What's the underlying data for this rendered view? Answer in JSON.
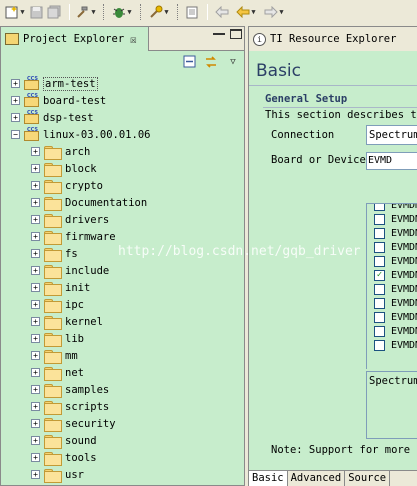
{
  "toolbar": {
    "icons": [
      "new-wizard-icon",
      "save-icon",
      "save-all-icon",
      "build-icon",
      "debug-icon",
      "run-tool-icon",
      "console-icon",
      "last-edit-icon",
      "back-icon",
      "forward-icon"
    ]
  },
  "project_explorer": {
    "tab_title": "Project Explorer",
    "tab_close": "☒",
    "projects": [
      {
        "label": "arm-test",
        "expanded": false
      },
      {
        "label": "board-test",
        "expanded": false
      },
      {
        "label": "dsp-test",
        "expanded": false
      },
      {
        "label": "linux-03.00.01.06",
        "expanded": true
      }
    ],
    "folders": [
      "arch",
      "block",
      "crypto",
      "Documentation",
      "drivers",
      "firmware",
      "fs",
      "include",
      "init",
      "ipc",
      "kernel",
      "lib",
      "mm",
      "net",
      "samples",
      "scripts",
      "security",
      "sound",
      "tools",
      "usr"
    ]
  },
  "resource_explorer": {
    "tab_title": "TI Resource Explorer",
    "heading": "Basic",
    "section_title": "General Setup",
    "section_desc": "This section describes th",
    "connection_label": "Connection",
    "connection_value": "Spectrum",
    "board_label": "Board or Device",
    "board_value": "EVMD",
    "board_list": [
      {
        "label": "EVMDM",
        "checked": false
      },
      {
        "label": "EVMDM",
        "checked": false
      },
      {
        "label": "EVMDM",
        "checked": false
      },
      {
        "label": "EVMDM",
        "checked": false
      },
      {
        "label": "EVMDM",
        "checked": false
      },
      {
        "label": "EVMDM",
        "checked": true
      },
      {
        "label": "EVMDM",
        "checked": false
      },
      {
        "label": "EVMDM",
        "checked": false
      },
      {
        "label": "EVMDM",
        "checked": false
      },
      {
        "label": "EVMDM",
        "checked": false
      },
      {
        "label": "EVMDM",
        "checked": false
      }
    ],
    "board_text": "Spectrum",
    "note": "Note: Support for more d",
    "bottom_tabs": [
      "Basic",
      "Advanced",
      "Source"
    ]
  },
  "watermark": "http://blog.csdn.net/gqb_driver"
}
